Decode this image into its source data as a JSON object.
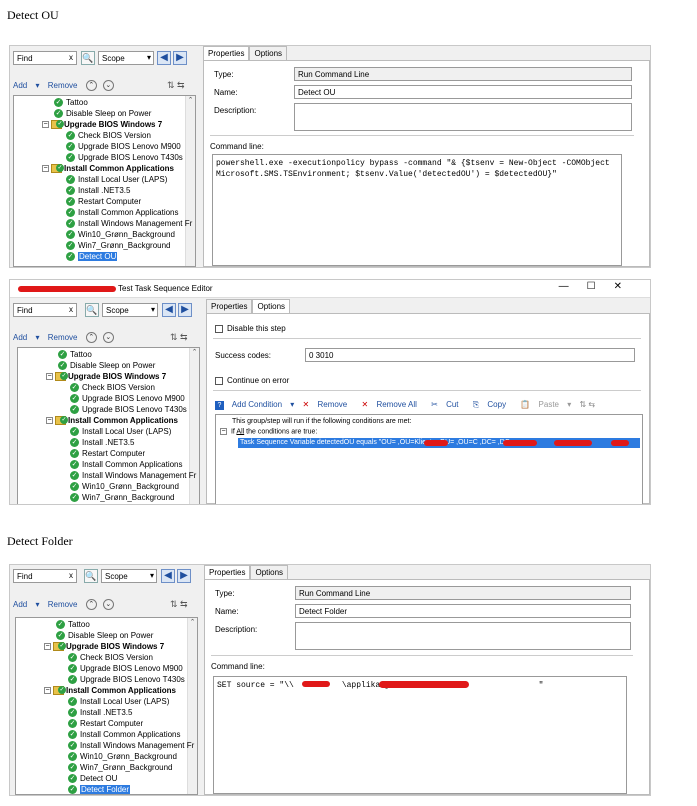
{
  "sections": [
    "Detect OU",
    "Detect Folder"
  ],
  "window_title": "Test Task Sequence Editor",
  "window_controls": [
    "—",
    "☐",
    "✕"
  ],
  "find": {
    "value": "Find",
    "clear": "x"
  },
  "scope": "Scope",
  "toolbar": {
    "add": "Add",
    "remove": "Remove"
  },
  "tabs": {
    "properties": "Properties",
    "options": "Options"
  },
  "tree1": [
    {
      "label": "Tattoo",
      "indent": 0,
      "type": "step"
    },
    {
      "label": "Disable Sleep on Power",
      "indent": 0,
      "type": "step"
    },
    {
      "label": "Upgrade BIOS Windows 7",
      "indent": 0,
      "type": "group"
    },
    {
      "label": "Check BIOS Version",
      "indent": 1,
      "type": "step"
    },
    {
      "label": "Upgrade BIOS Lenovo M900",
      "indent": 1,
      "type": "step"
    },
    {
      "label": "Upgrade BIOS Lenovo T430s",
      "indent": 1,
      "type": "step"
    },
    {
      "label": "Install Common Applications",
      "indent": 0,
      "type": "group"
    },
    {
      "label": "Install Local User (LAPS)",
      "indent": 1,
      "type": "step"
    },
    {
      "label": "Install .NET3.5",
      "indent": 1,
      "type": "step"
    },
    {
      "label": "Restart Computer",
      "indent": 1,
      "type": "step"
    },
    {
      "label": "Install Common Applications",
      "indent": 1,
      "type": "step"
    },
    {
      "label": "Install Windows Management Fr",
      "indent": 1,
      "type": "step"
    },
    {
      "label": "Win10_Grønn_Background",
      "indent": 1,
      "type": "step"
    },
    {
      "label": "Win7_Grønn_Background",
      "indent": 1,
      "type": "step"
    },
    {
      "label": "Detect OU",
      "indent": 1,
      "type": "step",
      "selected": true
    }
  ],
  "tree2": [
    {
      "label": "Tattoo",
      "indent": 0,
      "type": "step"
    },
    {
      "label": "Disable Sleep on Power",
      "indent": 0,
      "type": "step"
    },
    {
      "label": "Upgrade BIOS Windows 7",
      "indent": 0,
      "type": "group"
    },
    {
      "label": "Check BIOS Version",
      "indent": 1,
      "type": "step"
    },
    {
      "label": "Upgrade BIOS Lenovo M900",
      "indent": 1,
      "type": "step"
    },
    {
      "label": "Upgrade BIOS Lenovo T430s",
      "indent": 1,
      "type": "step"
    },
    {
      "label": "Install Common Applications",
      "indent": 0,
      "type": "group"
    },
    {
      "label": "Install Local User (LAPS)",
      "indent": 1,
      "type": "step"
    },
    {
      "label": "Install .NET3.5",
      "indent": 1,
      "type": "step"
    },
    {
      "label": "Restart Computer",
      "indent": 1,
      "type": "step"
    },
    {
      "label": "Install Common Applications",
      "indent": 1,
      "type": "step"
    },
    {
      "label": "Install Windows Management Fr",
      "indent": 1,
      "type": "step"
    },
    {
      "label": "Win10_Grønn_Background",
      "indent": 1,
      "type": "step"
    },
    {
      "label": "Win7_Grønn_Background",
      "indent": 1,
      "type": "step"
    }
  ],
  "tree3": [
    {
      "label": "Tattoo",
      "indent": 0,
      "type": "step"
    },
    {
      "label": "Disable Sleep on Power",
      "indent": 0,
      "type": "step"
    },
    {
      "label": "Upgrade BIOS Windows 7",
      "indent": 0,
      "type": "group"
    },
    {
      "label": "Check BIOS Version",
      "indent": 1,
      "type": "step"
    },
    {
      "label": "Upgrade BIOS Lenovo M900",
      "indent": 1,
      "type": "step"
    },
    {
      "label": "Upgrade BIOS Lenovo T430s",
      "indent": 1,
      "type": "step"
    },
    {
      "label": "Install Common Applications",
      "indent": 0,
      "type": "group"
    },
    {
      "label": "Install Local User (LAPS)",
      "indent": 1,
      "type": "step"
    },
    {
      "label": "Install .NET3.5",
      "indent": 1,
      "type": "step"
    },
    {
      "label": "Restart Computer",
      "indent": 1,
      "type": "step"
    },
    {
      "label": "Install Common Applications",
      "indent": 1,
      "type": "step"
    },
    {
      "label": "Install Windows Management Fr",
      "indent": 1,
      "type": "step"
    },
    {
      "label": "Win10_Grønn_Background",
      "indent": 1,
      "type": "step"
    },
    {
      "label": "Win7_Grønn_Background",
      "indent": 1,
      "type": "step"
    },
    {
      "label": "Detect OU",
      "indent": 1,
      "type": "step"
    },
    {
      "label": "Detect Folder",
      "indent": 1,
      "type": "step",
      "selected": true
    }
  ],
  "props": {
    "type_label": "Type:",
    "name_label": "Name:",
    "desc_label": "Description:",
    "cmd_label": "Command line:",
    "type_value": "Run Command Line"
  },
  "panel1": {
    "name_value": "Detect OU",
    "command": "powershell.exe -executionpolicy bypass -command \"& {$tsenv = New-Object -COMObject Microsoft.SMS.TSEnvironment; $tsenv.Value('detectedOU') = $detectedOU}\""
  },
  "panel2": {
    "disable_step": "Disable this step",
    "success_label": "Success codes:",
    "success_value": "0 3010",
    "continue_on_error": "Continue on error",
    "add_condition": "Add Condition",
    "remove": "Remove",
    "remove_all": "Remove All",
    "cut": "Cut",
    "copy": "Copy",
    "paste": "Paste",
    "cond_intro": "This group/step will run if the following conditions are met:",
    "cond_if": "If",
    "cond_all": "All",
    "cond_rest": "the conditions are true:",
    "cond_item": "Task Sequence Variable  detectedOU equals \"OU=          ,OU=Klienter,OU=          ,OU=C          ,DC=      ,DC="
  },
  "panel3": {
    "name_value": "Detect Folder",
    "command": "SET source = \"\\\\          \\applikasjo                              \""
  }
}
